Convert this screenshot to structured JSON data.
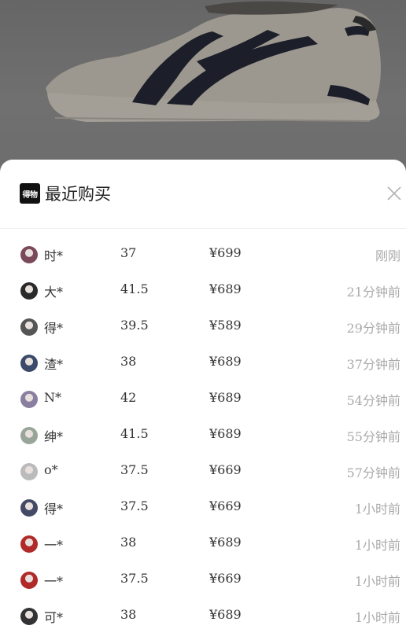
{
  "header": {
    "logo_text": "得物",
    "title": "最近购买",
    "close_icon": "close-icon"
  },
  "purchases": [
    {
      "name": "时*",
      "size": "37",
      "price": "¥699",
      "time": "刚刚",
      "avatar_color": "#7a4a5a"
    },
    {
      "name": "大*",
      "size": "41.5",
      "price": "¥689",
      "time": "21分钟前",
      "avatar_color": "#2a2a2a"
    },
    {
      "name": "得*",
      "size": "39.5",
      "price": "¥589",
      "time": "29分钟前",
      "avatar_color": "#555555"
    },
    {
      "name": "渣*",
      "size": "38",
      "price": "¥689",
      "time": "37分钟前",
      "avatar_color": "#3b4a6a"
    },
    {
      "name": "N*",
      "size": "42",
      "price": "¥689",
      "time": "54分钟前",
      "avatar_color": "#8a7fa0"
    },
    {
      "name": "绅*",
      "size": "41.5",
      "price": "¥689",
      "time": "55分钟前",
      "avatar_color": "#9aa59a"
    },
    {
      "name": "o*",
      "size": "37.5",
      "price": "¥669",
      "time": "57分钟前",
      "avatar_color": "#bbbbbb"
    },
    {
      "name": "得*",
      "size": "37.5",
      "price": "¥669",
      "time": "1小时前",
      "avatar_color": "#444a66"
    },
    {
      "name": "一*",
      "size": "38",
      "price": "¥689",
      "time": "1小时前",
      "avatar_color": "#b02a2a"
    },
    {
      "name": "一*",
      "size": "37.5",
      "price": "¥669",
      "time": "1小时前",
      "avatar_color": "#b02a2a"
    },
    {
      "name": "可*",
      "size": "38",
      "price": "¥689",
      "time": "1小时前",
      "avatar_color": "#333333"
    }
  ]
}
